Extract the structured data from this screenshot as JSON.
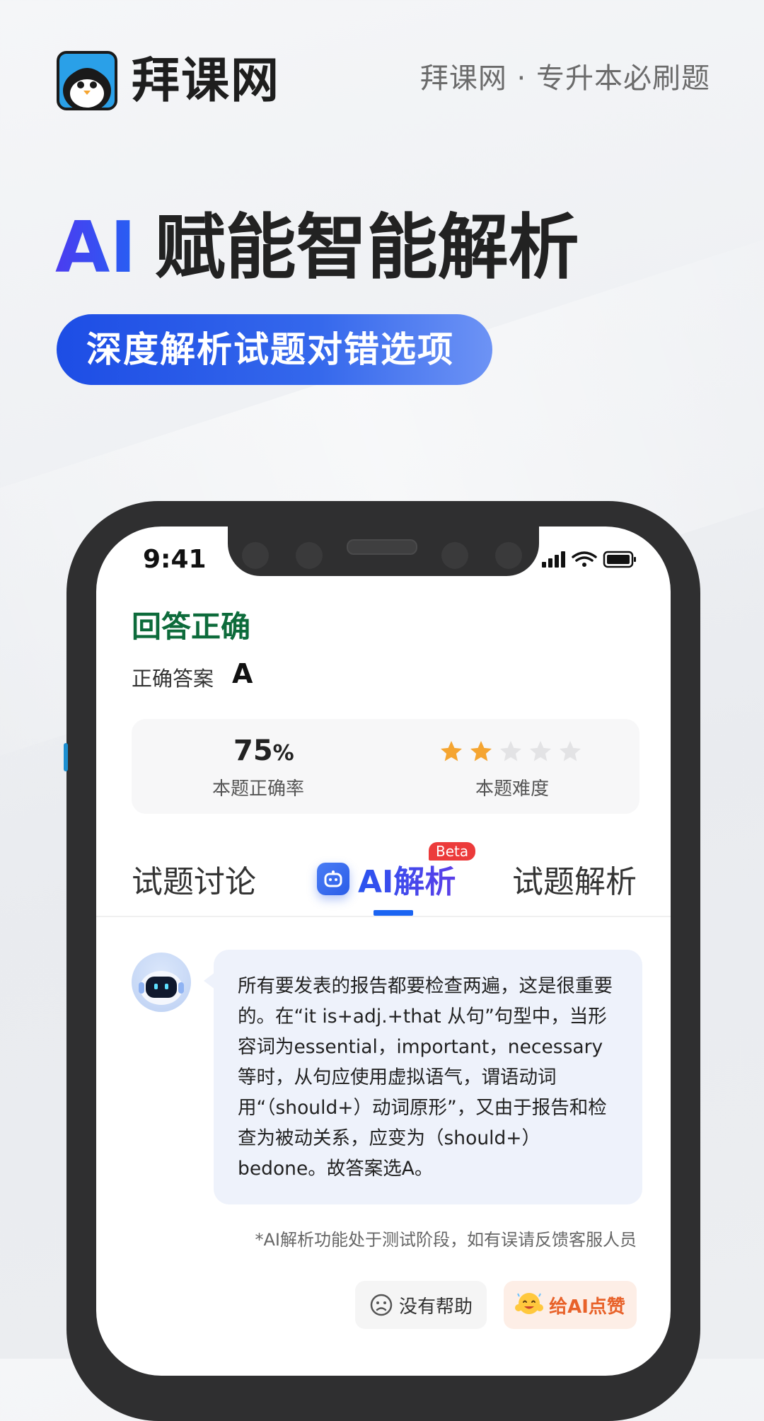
{
  "header": {
    "brand_name": "拜课网",
    "tagline": "拜课网 · 专升本必刷题"
  },
  "headline": {
    "ai": "AI",
    "title": "赋能智能解析",
    "subtitle": "深度解析试题对错选项"
  },
  "status_bar": {
    "time": "9:41"
  },
  "result": {
    "title": "回答正确",
    "answer_label": "正确答案",
    "answer_value": "A"
  },
  "stats": {
    "rate_value": "75",
    "rate_unit": "%",
    "rate_label": "本题正确率",
    "difficulty_stars_filled": 2,
    "difficulty_stars_total": 5,
    "difficulty_label": "本题难度"
  },
  "tabs": {
    "discuss": "试题讨论",
    "ai": "AI解析",
    "ai_badge": "Beta",
    "explain": "试题解析"
  },
  "ai_analysis": {
    "text": "所有要发表的报告都要检查两遍，这是很重要的。在“it is+adj.+that 从句”句型中，当形容词为essential，important，necessary等时，从句应使用虚拟语气，谓语动词用“（should+）动词原形”，又由于报告和检查为被动关系，应变为（should+）bedone。故答案选A。",
    "disclaimer": "*AI解析功能处于测试阶段，如有误请反馈客服人员"
  },
  "actions": {
    "no_help": "没有帮助",
    "like": "给AI点赞"
  },
  "colors": {
    "brand_blue": "#1d4de5",
    "correct_green": "#0d6b3b",
    "star_filled": "#f5a531",
    "star_empty": "#e3e3e5",
    "tab_active": "#1b64f2",
    "beta_red": "#ec3b3b"
  }
}
